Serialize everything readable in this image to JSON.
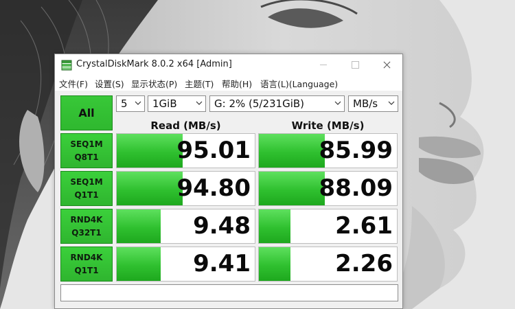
{
  "window": {
    "title": "CrystalDiskMark 8.0.2 x64 [Admin]"
  },
  "menu": [
    {
      "label": "文件(F)"
    },
    {
      "label": "设置(S)"
    },
    {
      "label": "显示状态(P)"
    },
    {
      "label": "主题(T)"
    },
    {
      "label": "帮助(H)"
    },
    {
      "label": "语言(L)(Language)"
    }
  ],
  "controls": {
    "all_label": "All",
    "count": "5",
    "size": "1GiB",
    "drive": "G: 2% (5/231GiB)",
    "unit": "MB/s"
  },
  "headers": {
    "read": "Read (MB/s)",
    "write": "Write (MB/s)"
  },
  "tests": [
    {
      "line1": "SEQ1M",
      "line2": "Q8T1",
      "read": "95.01",
      "write": "85.99",
      "read_fill": 0.48,
      "write_fill": 0.48
    },
    {
      "line1": "SEQ1M",
      "line2": "Q1T1",
      "read": "94.80",
      "write": "88.09",
      "read_fill": 0.48,
      "write_fill": 0.48
    },
    {
      "line1": "RND4K",
      "line2": "Q32T1",
      "read": "9.48",
      "write": "2.61",
      "read_fill": 0.32,
      "write_fill": 0.23
    },
    {
      "line1": "RND4K",
      "line2": "Q1T1",
      "read": "9.41",
      "write": "2.26",
      "read_fill": 0.32,
      "write_fill": 0.23
    }
  ],
  "comment": ""
}
